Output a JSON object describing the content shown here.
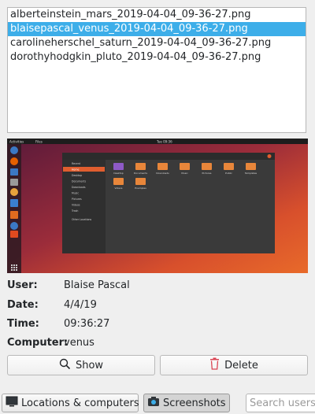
{
  "files": [
    "alberteinstein_mars_2019-04-04_09-36-27.png",
    "blaisepascal_venus_2019-04-04_09-36-27.png",
    "carolineherschel_saturn_2019-04-04_09-36-27.png",
    "dorothyhodgkin_pluto_2019-04-04_09-36-27.png"
  ],
  "selected_file_index": 1,
  "preview": {
    "topbar_left": "Activities",
    "topbar_app": "Files",
    "topbar_clock": "Tue 09:36",
    "sidebar_items": [
      "Recent",
      "Home",
      "Desktop",
      "Documents",
      "Downloads",
      "Music",
      "Pictures",
      "Videos",
      "Trash",
      "Other Locations"
    ],
    "folders": [
      "Desktop",
      "Documents",
      "Downloads",
      "Music",
      "Pictures",
      "Public",
      "Templates",
      "Videos",
      "Examples"
    ]
  },
  "info": {
    "user_label": "User:",
    "user_value": "Blaise Pascal",
    "date_label": "Date:",
    "date_value": "4/4/19",
    "time_label": "Time:",
    "time_value": "09:36:27",
    "computer_label": "Computer:",
    "computer_value": "venus"
  },
  "actions": {
    "show_label": "Show",
    "delete_label": "Delete"
  },
  "bottom": {
    "locations_label": "Locations & computers",
    "screenshots_label": "Screenshots",
    "search_placeholder": "Search users and"
  },
  "colors": {
    "selection": "#3daee9",
    "delete_icon": "#da4453"
  }
}
